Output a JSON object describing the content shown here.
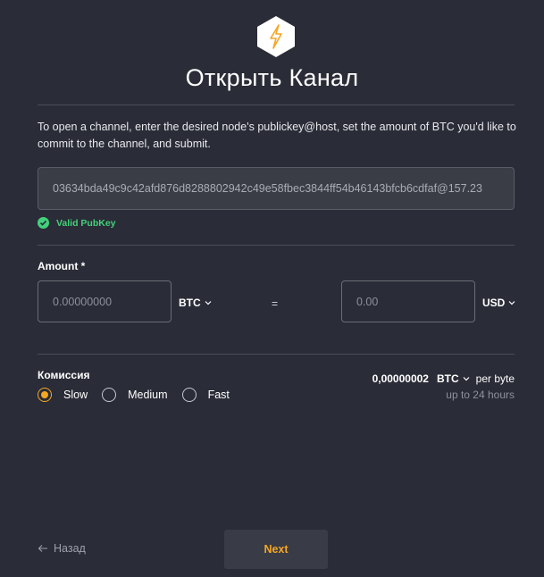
{
  "header": {
    "logo_icon": "lightning-hexagon-icon",
    "title": "Открыть Канал"
  },
  "intro_text": "To open a channel, enter the desired node's publickey@host, set the amount of BTC you'd like to commit to the channel, and submit.",
  "pubkey": {
    "value": "03634bda49c9c42afd876d8288802942c49e58fbec3844ff54b46143bfcb6cdfaf@157.23",
    "status": "Valid PubKey",
    "status_color": "#42d17b"
  },
  "amount": {
    "label": "Amount *",
    "crypto_placeholder": "0.00000000",
    "crypto_unit": "BTC",
    "equals": "=",
    "fiat_placeholder": "0.00",
    "fiat_unit": "USD"
  },
  "fee": {
    "label": "Комиссия",
    "options": [
      "Slow",
      "Medium",
      "Fast"
    ],
    "selected": "Slow",
    "amount": "0,00000002",
    "unit": "BTC",
    "per": "per byte",
    "time": "up to 24 hours"
  },
  "footer": {
    "back_label": "Назад",
    "next_label": "Next"
  },
  "colors": {
    "background": "#2a2c37",
    "accent": "#f5a623",
    "success": "#42d17b"
  }
}
